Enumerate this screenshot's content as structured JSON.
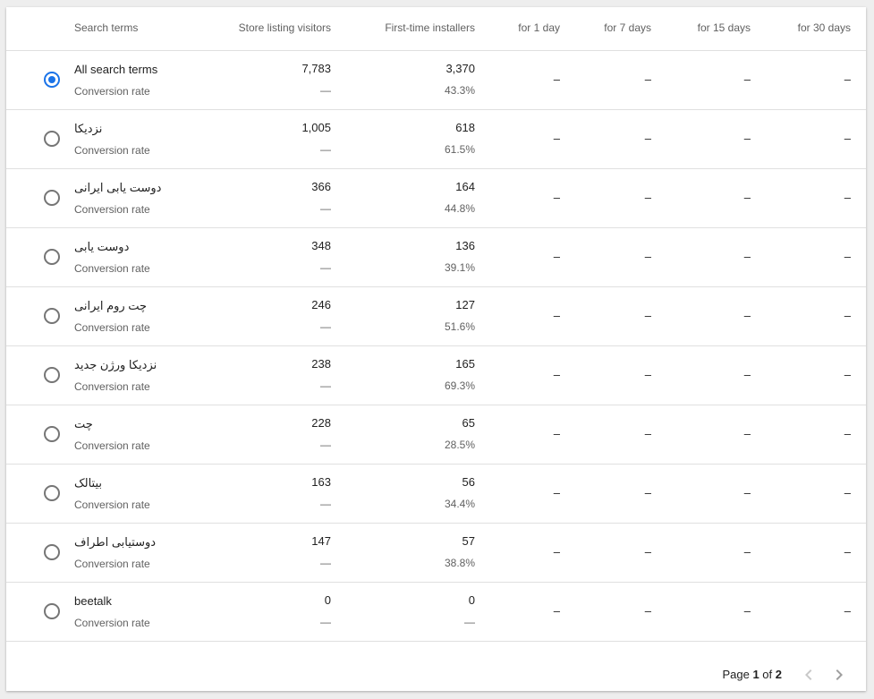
{
  "header": {
    "search_terms": "Search terms",
    "store_listing_visitors": "Store listing visitors",
    "first_time_installers": "First-time installers",
    "for_1_day": "for 1 day",
    "for_7_days": "for 7 days",
    "for_15_days": "for 15 days",
    "for_30_days": "for 30 days"
  },
  "rows": [
    {
      "term": "All search terms",
      "sublabel": "Conversion rate",
      "visitors": "7,783",
      "visitors_sub": "—",
      "installers": "3,370",
      "rate": "43.3%",
      "d1": "–",
      "d7": "–",
      "d15": "–",
      "d30": "–",
      "selected": true
    },
    {
      "term": "نزدیکا",
      "sublabel": "Conversion rate",
      "visitors": "1,005",
      "visitors_sub": "—",
      "installers": "618",
      "rate": "61.5%",
      "d1": "–",
      "d7": "–",
      "d15": "–",
      "d30": "–",
      "selected": false
    },
    {
      "term": "دوست یابی ایرانی",
      "sublabel": "Conversion rate",
      "visitors": "366",
      "visitors_sub": "—",
      "installers": "164",
      "rate": "44.8%",
      "d1": "–",
      "d7": "–",
      "d15": "–",
      "d30": "–",
      "selected": false
    },
    {
      "term": "دوست یابی",
      "sublabel": "Conversion rate",
      "visitors": "348",
      "visitors_sub": "—",
      "installers": "136",
      "rate": "39.1%",
      "d1": "–",
      "d7": "–",
      "d15": "–",
      "d30": "–",
      "selected": false
    },
    {
      "term": "چت روم ایرانی",
      "sublabel": "Conversion rate",
      "visitors": "246",
      "visitors_sub": "—",
      "installers": "127",
      "rate": "51.6%",
      "d1": "–",
      "d7": "–",
      "d15": "–",
      "d30": "–",
      "selected": false
    },
    {
      "term": "نزدیکا ورژن جدید",
      "sublabel": "Conversion rate",
      "visitors": "238",
      "visitors_sub": "—",
      "installers": "165",
      "rate": "69.3%",
      "d1": "–",
      "d7": "–",
      "d15": "–",
      "d30": "–",
      "selected": false
    },
    {
      "term": "چت",
      "sublabel": "Conversion rate",
      "visitors": "228",
      "visitors_sub": "—",
      "installers": "65",
      "rate": "28.5%",
      "d1": "–",
      "d7": "–",
      "d15": "–",
      "d30": "–",
      "selected": false
    },
    {
      "term": "بیتالک",
      "sublabel": "Conversion rate",
      "visitors": "163",
      "visitors_sub": "—",
      "installers": "56",
      "rate": "34.4%",
      "d1": "–",
      "d7": "–",
      "d15": "–",
      "d30": "–",
      "selected": false
    },
    {
      "term": "دوستیابی اطراف",
      "sublabel": "Conversion rate",
      "visitors": "147",
      "visitors_sub": "—",
      "installers": "57",
      "rate": "38.8%",
      "d1": "–",
      "d7": "–",
      "d15": "–",
      "d30": "–",
      "selected": false
    },
    {
      "term": "beetalk",
      "sublabel": "Conversion rate",
      "visitors": "0",
      "visitors_sub": "—",
      "installers": "0",
      "rate": "—",
      "d1": "–",
      "d7": "–",
      "d15": "–",
      "d30": "–",
      "selected": false
    }
  ],
  "pagination": {
    "page_label": "Page",
    "current": "1",
    "of_label": "of",
    "total": "2",
    "prev_icon": "chevron-left-icon",
    "next_icon": "chevron-right-icon"
  },
  "colors": {
    "accent": "#1a73e8",
    "divider": "#e0e0e0",
    "secondary_text": "#616161"
  }
}
